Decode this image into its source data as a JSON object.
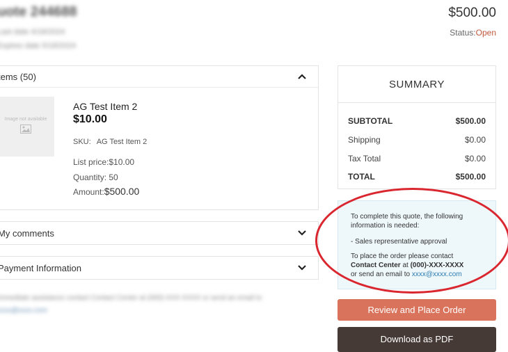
{
  "header": {
    "quote_title": "uote 244688",
    "created": "Last date 4/18/2024",
    "expires": "Expires date 5/18/2024",
    "total": "$500.00",
    "status_label": "Status:",
    "status_value": "Open",
    "status_color": "#c0583b"
  },
  "items_panel": {
    "title": "tems (50)",
    "image_placeholder_text": "Image not available",
    "item": {
      "name": "AG Test Item 2",
      "price": "$10.00",
      "sku_label": "SKU:",
      "sku_value": "AG Test Item 2",
      "list_price_label": "List price:",
      "list_price_value": "$10.00",
      "quantity_label": "Quantity:",
      "quantity_value": "50",
      "amount_label": "Amount:",
      "amount_value": "$500.00"
    }
  },
  "comments_panel": {
    "title": "My comments"
  },
  "payment_panel": {
    "title": "Payment Information"
  },
  "footer_note": {
    "text": "Immediate assistance contact Contact Center at (000)-XXX-XXXX or send an email to",
    "link": "xxxx@xxxx.com"
  },
  "summary": {
    "title": "SUMMARY",
    "rows": [
      {
        "label": "SUBTOTAL",
        "value": "$500.00"
      },
      {
        "label": "Shipping",
        "value": "$0.00"
      },
      {
        "label": "Tax Total",
        "value": "$0.00"
      },
      {
        "label": "TOTAL",
        "value": "$500.00"
      }
    ]
  },
  "notice": {
    "line1": "To complete this quote, the following information is needed:",
    "line2": "- Sales representative approval",
    "line3_prefix": "To place the order please contact",
    "contact_name": "Contact Center",
    "at_text": "at",
    "phone": "(000)-XXX-XXXX",
    "email_prefix": "or send an email to",
    "email": "xxxx@xxxx.com"
  },
  "actions": {
    "review_label": "Review and Place Order",
    "pdf_label": "Download as PDF",
    "review_color": "#d9735b",
    "pdf_color": "#463a36"
  },
  "icons": {
    "items_toggle": "chevron-up-icon",
    "comments_toggle": "chevron-down-icon",
    "payment_toggle": "chevron-down-icon",
    "placeholder": "image-icon"
  }
}
